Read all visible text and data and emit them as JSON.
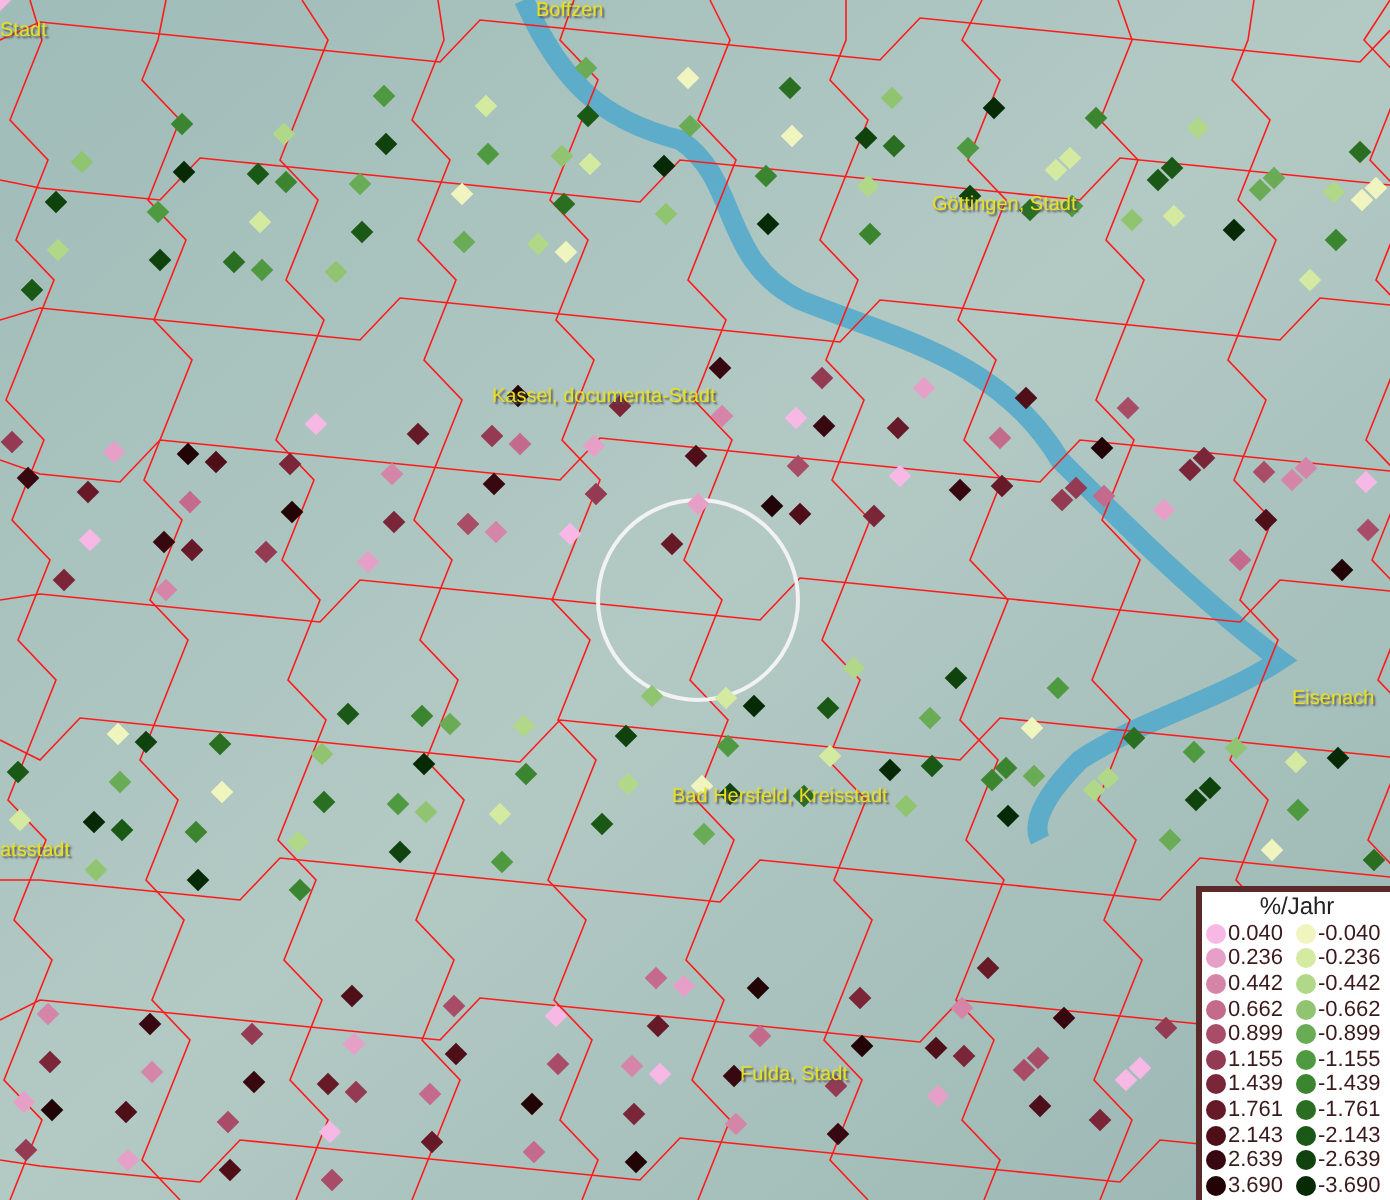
{
  "map": {
    "places": [
      {
        "name": "Stadt"
      },
      {
        "name": "Boffzen"
      },
      {
        "name": "Göttingen, Stadt"
      },
      {
        "name": "Kassel, documenta-Stadt"
      },
      {
        "name": "Eisenach"
      },
      {
        "name": "atsstadt"
      },
      {
        "name": "Bad Hersfeld, Kreisstadt"
      },
      {
        "name": "Fulda, Stadt"
      }
    ]
  },
  "legend": {
    "title": "%/Jahr",
    "rows": [
      {
        "increase": {
          "label": "0.040",
          "color": "#f7b8e6"
        },
        "decrease": {
          "label": "-0.040",
          "color": "#f0f5c0"
        }
      },
      {
        "increase": {
          "label": "0.236",
          "color": "#e6a0c8"
        },
        "decrease": {
          "label": "-0.236",
          "color": "#d4eaa0"
        }
      },
      {
        "increase": {
          "label": "0.442",
          "color": "#d485a8"
        },
        "decrease": {
          "label": "-0.442",
          "color": "#b0d888"
        }
      },
      {
        "increase": {
          "label": "0.662",
          "color": "#c46a8a"
        },
        "decrease": {
          "label": "-0.662",
          "color": "#90c470"
        }
      },
      {
        "increase": {
          "label": "0.899",
          "color": "#a84c68"
        },
        "decrease": {
          "label": "-0.899",
          "color": "#6aab55"
        }
      },
      {
        "increase": {
          "label": "1.155",
          "color": "#943a52"
        },
        "decrease": {
          "label": "-1.155",
          "color": "#4f9a40"
        }
      },
      {
        "increase": {
          "label": "1.439",
          "color": "#7a2638"
        },
        "decrease": {
          "label": "-1.439",
          "color": "#3c8530"
        }
      },
      {
        "increase": {
          "label": "1.761",
          "color": "#661a28"
        },
        "decrease": {
          "label": "-1.761",
          "color": "#2a6e22"
        }
      },
      {
        "increase": {
          "label": "2.143",
          "color": "#4e0f18"
        },
        "decrease": {
          "label": "-2.143",
          "color": "#1a5815"
        }
      },
      {
        "increase": {
          "label": "2.639",
          "color": "#380810"
        },
        "decrease": {
          "label": "-2.639",
          "color": "#0f420c"
        }
      },
      {
        "increase": {
          "label": "3.690",
          "color": "#220306"
        },
        "decrease": {
          "label": "-3.690",
          "color": "#062a05"
        }
      }
    ]
  }
}
